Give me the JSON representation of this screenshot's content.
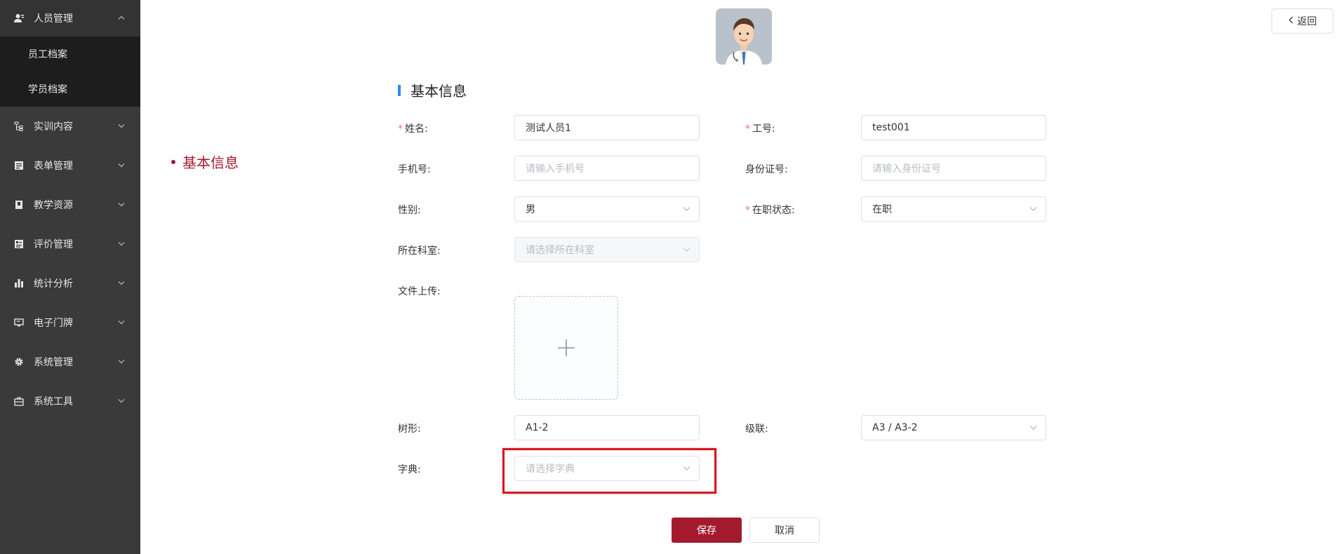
{
  "sidebar": {
    "items": [
      {
        "label": "人员管理",
        "icon": "user-icon",
        "expanded": true,
        "children": [
          {
            "label": "员工档案"
          },
          {
            "label": "学员档案"
          }
        ]
      },
      {
        "label": "实训内容",
        "icon": "tree-icon"
      },
      {
        "label": "表单管理",
        "icon": "form-icon"
      },
      {
        "label": "教学资源",
        "icon": "book-icon"
      },
      {
        "label": "评价管理",
        "icon": "rating-icon"
      },
      {
        "label": "统计分析",
        "icon": "bar-chart-icon"
      },
      {
        "label": "电子门牌",
        "icon": "monitor-icon"
      },
      {
        "label": "系统管理",
        "icon": "gear-icon"
      },
      {
        "label": "系统工具",
        "icon": "toolbox-icon"
      }
    ]
  },
  "header": {
    "back_label": "返回",
    "avatar_icon": "doctor-avatar"
  },
  "anchor_nav": {
    "label": "基本信息"
  },
  "section": {
    "title": "基本信息"
  },
  "form": {
    "name": {
      "label": "姓名:",
      "required": true,
      "value": "测试人员1"
    },
    "job_no": {
      "label": "工号:",
      "required": true,
      "value": "test001"
    },
    "phone": {
      "label": "手机号:",
      "placeholder": "请输入手机号"
    },
    "id_card": {
      "label": "身份证号:",
      "placeholder": "请输入身份证号"
    },
    "gender": {
      "label": "性别:",
      "value": "男"
    },
    "status": {
      "label": "在职状态:",
      "required": true,
      "value": "在职"
    },
    "dept": {
      "label": "所在科室:",
      "placeholder": "请选择所在科室",
      "disabled": true
    },
    "upload": {
      "label": "文件上传:"
    },
    "tree": {
      "label": "树形:",
      "value": "A1-2"
    },
    "cascade": {
      "label": "级联:",
      "value": "A3 / A3-2"
    },
    "dict": {
      "label": "字典:",
      "placeholder": "请选择字典"
    }
  },
  "actions": {
    "save_label": "保存",
    "cancel_label": "取消"
  },
  "colors": {
    "sidebar_bg": "#3a3a3a",
    "submenu_bg": "#1d1d1d",
    "primary": "#a31a2e",
    "section_bar": "#2d8cf0",
    "highlight_box": "#d9141f"
  }
}
